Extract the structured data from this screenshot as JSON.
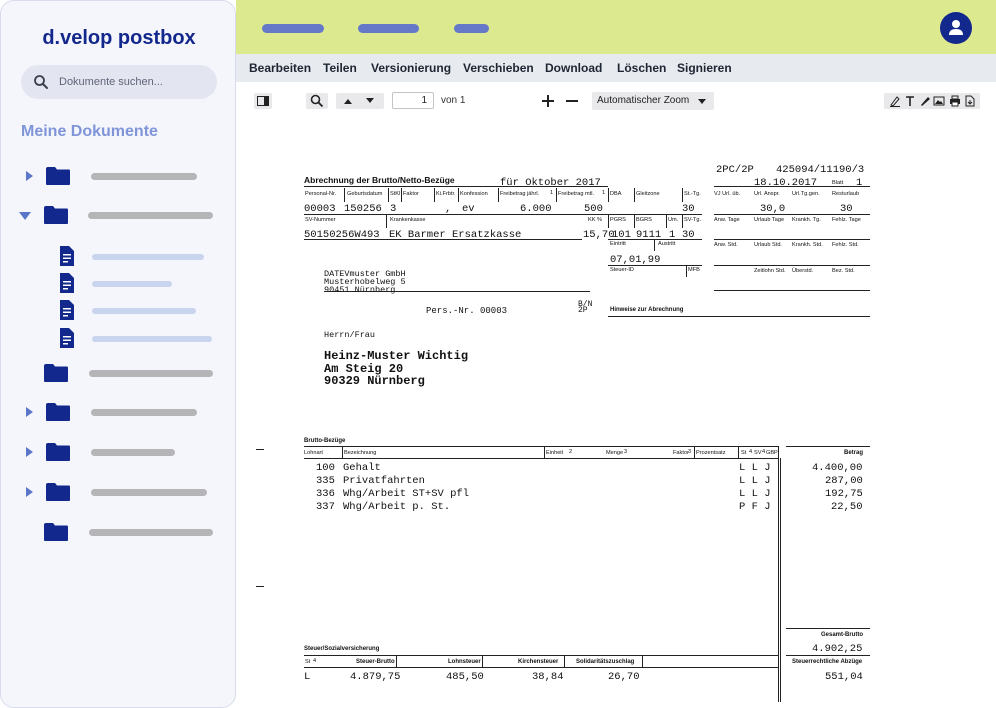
{
  "sidebar": {
    "brand": "d.velop postbox",
    "search_placeholder": "Dokumente suchen...",
    "section_title": "Meine Dokumente"
  },
  "menu": {
    "items": [
      "Bearbeiten",
      "Teilen",
      "Versionierung",
      "Verschieben",
      "Download",
      "Löschen",
      "Signieren"
    ]
  },
  "viewer": {
    "page_current": "1",
    "page_of": "von 1",
    "zoom": "Automatischer Zoom"
  },
  "document": {
    "title": "Abrechnung der Brutto/Netto-Bezüge",
    "period": "für Oktober 2017",
    "ref_code": "2PC/2P",
    "ref_number": "425094/11190/3",
    "date": "18.10.2017",
    "sheet_label": "Blatt",
    "sheet_no": "1",
    "hdr_row1": [
      "Personal-Nr.",
      "Geburtsdatum",
      "StKl",
      "Faktor",
      "Ki.Frbtr.",
      "Konfession",
      "Freibetrag jährl.",
      "1",
      "Freibetrag mtl.",
      "1",
      "DBA",
      "Gleitzone",
      "St.-Tg."
    ],
    "val_row1": [
      "00003",
      "150256",
      "3",
      ",",
      "ev",
      "6.000",
      "500",
      "30"
    ],
    "hdr_row2": [
      "SV-Nummer",
      "Krankenkasse",
      "KK %",
      "PGRS",
      "BGRS",
      "Um.",
      "SV-Tg."
    ],
    "val_row2": [
      "50150256W493",
      "EK Barmer Ersatzkasse",
      "15,70",
      "101",
      "9111",
      "1",
      "30"
    ],
    "eintritt_label": "Eintritt",
    "austritt_label": "Austritt",
    "eintritt": "07,01,99",
    "steuer_id_label": "Steuer-ID",
    "mfb_label": "MFB",
    "right_hdr1": [
      "VJ Url. üb.",
      "Url. Anspr.",
      "Url.Tg.gen.",
      "Resturlaub"
    ],
    "right_val1": [
      "30,0",
      "30"
    ],
    "right_hdr2": [
      "Anw. Tage",
      "Urlaub Tage",
      "Krankh. Tg.",
      "Fehlz. Tage"
    ],
    "right_hdr3": [
      "Anw. Std.",
      "Urlaub Std.",
      "Krankh. Std.",
      "Fehlz. Std."
    ],
    "right_hdr4": [
      "Zeitlohn Std.",
      "Überstd.",
      "Bez. Std."
    ],
    "sender": [
      "DATEVmuster GmbH",
      "Musterhobelweg 5",
      "90451 Nürnberg"
    ],
    "pers_nr": "Pers.-Nr. 00003",
    "bn": "B/N",
    "bn2": "2P",
    "hinweise": "Hinweise zur Abrechnung",
    "salutation": "Herrn/Frau",
    "recipient": [
      "Heinz-Muster Wichtig",
      "Am Steig 20",
      "90329 Nürnberg"
    ],
    "brutto_title": "Brutto-Bezüge",
    "brutto_hdr": [
      "Lohnart",
      "Bezeichnung",
      "Einheit",
      "2",
      "Menge",
      "3",
      "Faktor",
      "3",
      "Prozentsatz",
      "St",
      "4",
      "SV",
      "4",
      "GB",
      "P",
      "Betrag"
    ],
    "brutto_rows": [
      {
        "code": "100",
        "name": "Gehalt",
        "flags": "L L J",
        "amount": "4.400,00"
      },
      {
        "code": "335",
        "name": "Privatfahrten",
        "flags": "L L J",
        "amount": "287,00"
      },
      {
        "code": "336",
        "name": "Whg/Arbeit ST+SV pfl",
        "flags": "L L J",
        "amount": "192,75"
      },
      {
        "code": "337",
        "name": "Whg/Arbeit p. St.",
        "flags": "P F J",
        "amount": "22,50"
      }
    ],
    "gesamt_label": "Gesamt-Brutto",
    "gesamt": "4.902,25",
    "steuer_title": "Steuer/Sozialversicherung",
    "steuer_hdr": [
      "St",
      "4",
      "Steuer-Brutto",
      "Lohnsteuer",
      "Kirchensteuer",
      "Solidaritätszuschlag"
    ],
    "steuer_vals": [
      "L",
      "4.879,75",
      "485,50",
      "38,84",
      "26,70"
    ],
    "abzuege_label": "Steuerrechtliche Abzüge",
    "abzuege": "551,04"
  }
}
